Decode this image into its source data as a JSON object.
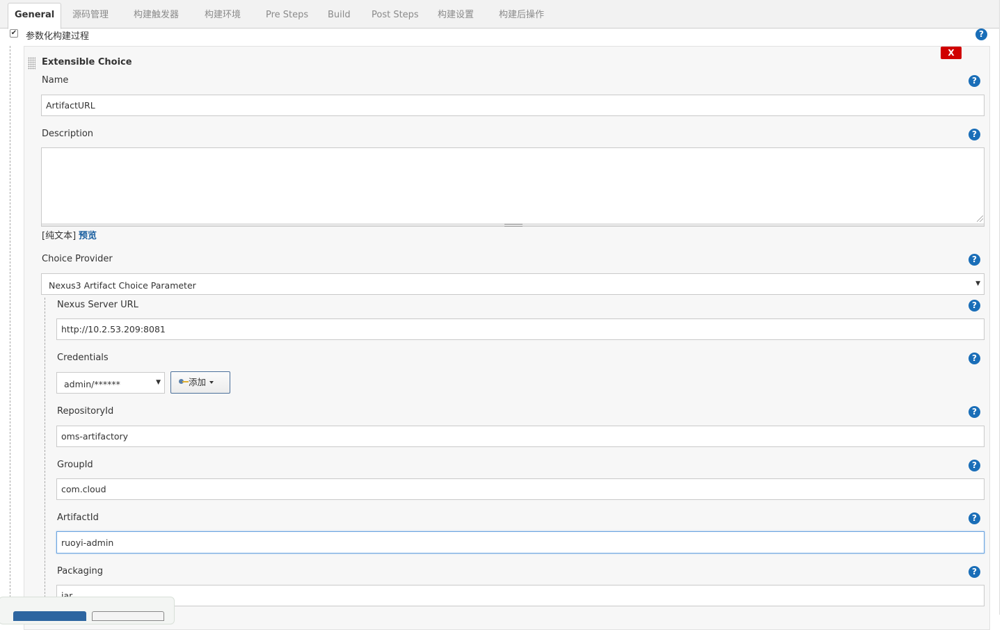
{
  "tabs": [
    {
      "label": "General",
      "active": true
    },
    {
      "label": "源码管理"
    },
    {
      "label": "构建触发器"
    },
    {
      "label": "构建环境"
    },
    {
      "label": "Pre Steps"
    },
    {
      "label": "Build"
    },
    {
      "label": "Post Steps"
    },
    {
      "label": "构建设置"
    },
    {
      "label": "构建后操作"
    }
  ],
  "parameterized": {
    "label": "参数化构建过程",
    "checked": true
  },
  "param_block": {
    "title": "Extensible Choice",
    "delete_label": "X",
    "name": {
      "label": "Name",
      "value": "ArtifactURL"
    },
    "description": {
      "label": "Description",
      "value": ""
    },
    "plain_text_label": "[纯文本]",
    "preview_label": "预览",
    "choice_provider": {
      "label": "Choice Provider",
      "selected": "Nexus3 Artifact Choice Parameter"
    },
    "nexus_server_url": {
      "label": "Nexus Server URL",
      "value": "http://10.2.53.209:8081"
    },
    "credentials": {
      "label": "Credentials",
      "selected": "admin/******",
      "add_label": "添加"
    },
    "repository_id": {
      "label": "RepositoryId",
      "value": "oms-artifactory"
    },
    "group_id": {
      "label": "GroupId",
      "value": "com.cloud"
    },
    "artifact_id": {
      "label": "ArtifactId",
      "value": "ruoyi-admin"
    },
    "packaging": {
      "label": "Packaging",
      "value": "jar"
    }
  },
  "icons": {
    "help": "?",
    "checkmark": "✔",
    "dropdown_arrow": "▼"
  },
  "colors": {
    "help_icon": "#1a6eb8",
    "delete_button": "#d00000",
    "link": "#1a5fa0",
    "save_button": "#2d65a0"
  }
}
